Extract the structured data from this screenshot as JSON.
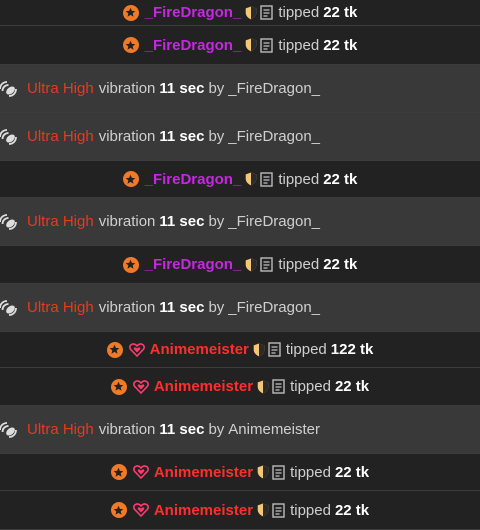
{
  "rows": [
    {
      "type": "tip",
      "user": "_FireDragon_",
      "verb": "tipped",
      "amount": "22 tk"
    },
    {
      "type": "tip",
      "user": "_FireDragon_",
      "verb": "tipped",
      "amount": "22 tk"
    },
    {
      "type": "vibe",
      "level": "Ultra High",
      "label": "vibration",
      "seconds": "11 sec",
      "by": "by",
      "user": "_FireDragon_"
    },
    {
      "type": "vibe",
      "level": "Ultra High",
      "label": "vibration",
      "seconds": "11 sec",
      "by": "by",
      "user": "_FireDragon_"
    },
    {
      "type": "tip",
      "user": "_FireDragon_",
      "verb": "tipped",
      "amount": "22 tk"
    },
    {
      "type": "vibe",
      "level": "Ultra High",
      "label": "vibration",
      "seconds": "11 sec",
      "by": "by",
      "user": "_FireDragon_"
    },
    {
      "type": "tip",
      "user": "_FireDragon_",
      "verb": "tipped",
      "amount": "22 tk"
    },
    {
      "type": "vibe",
      "level": "Ultra High",
      "label": "vibration",
      "seconds": "11 sec",
      "by": "by",
      "user": "_FireDragon_"
    },
    {
      "type": "tip",
      "user": "Animemeister",
      "verb": "tipped",
      "amount": "122 tk"
    },
    {
      "type": "tip",
      "user": "Animemeister",
      "verb": "tipped",
      "amount": "22 tk"
    },
    {
      "type": "vibe",
      "level": "Ultra High",
      "label": "vibration",
      "seconds": "11 sec",
      "by": "by",
      "user": "Animemeister"
    },
    {
      "type": "tip",
      "user": "Animemeister",
      "verb": "tipped",
      "amount": "22 tk"
    },
    {
      "type": "tip",
      "user": "Animemeister",
      "verb": "tipped",
      "amount": "22 tk"
    }
  ],
  "colors": {
    "fire_dragon_name": "#c528e0",
    "animemeister_name": "#ff2e2e",
    "level": "#e53b1f",
    "star_badge": "#f07a27",
    "shield_fill": "#f2c777"
  },
  "icons": {
    "star_badge": "star-badge-icon",
    "heart_badge": "heart-badge-icon",
    "shield": "shield-icon",
    "document": "document-icon",
    "vibration": "vibration-icon"
  }
}
